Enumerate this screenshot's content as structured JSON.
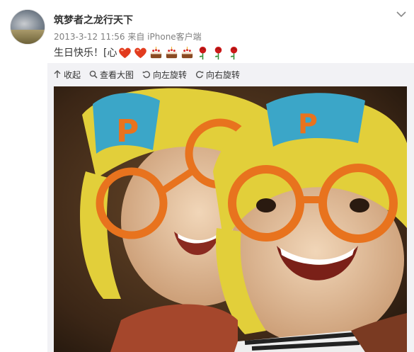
{
  "user": {
    "name": "筑梦者之龙行天下",
    "avatar": "landscape-avatar"
  },
  "meta": {
    "datetime": "2013-3-12 11:56",
    "source_prefix": "来自",
    "source": "iPhone客户端"
  },
  "post": {
    "text": "生日快乐！[心",
    "emoticons": [
      "heart-emoticon",
      "heart-emoticon",
      "cake-emoticon",
      "cake-emoticon",
      "cake-emoticon",
      "rose-emoticon",
      "rose-emoticon",
      "rose-emoticon"
    ]
  },
  "toolbar": {
    "collapse": "收起",
    "view_full": "查看大图",
    "rotate_left": "向左旋转",
    "rotate_right": "向右旋转"
  },
  "icons": {
    "more": "chevron-down-icon",
    "collapse": "arrow-up-icon",
    "view_full": "magnifier-icon",
    "rotate_left": "rotate-left-icon",
    "rotate_right": "rotate-right-icon"
  },
  "colors": {
    "username": "#333333",
    "meta": "#808080",
    "media_bg": "#f2f2f5",
    "helmet": "#e8d23a",
    "goggles": "#e8731e"
  }
}
